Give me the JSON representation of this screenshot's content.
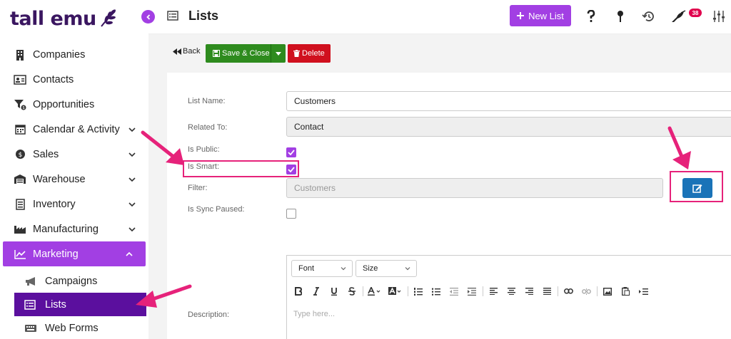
{
  "brand": {
    "name": "tall emu",
    "color": "#3a1660",
    "accent": "#a23fe3"
  },
  "sidebar": {
    "items": [
      {
        "label": "Companies",
        "icon": "building-icon",
        "expandable": false
      },
      {
        "label": "Contacts",
        "icon": "contact-card-icon",
        "expandable": false
      },
      {
        "label": "Opportunities",
        "icon": "funnel-icon",
        "expandable": false
      },
      {
        "label": "Calendar & Activity",
        "icon": "calendar-icon",
        "expandable": true
      },
      {
        "label": "Sales",
        "icon": "dollar-coin-icon",
        "expandable": true
      },
      {
        "label": "Warehouse",
        "icon": "warehouse-icon",
        "expandable": true
      },
      {
        "label": "Inventory",
        "icon": "inventory-icon",
        "expandable": true
      },
      {
        "label": "Manufacturing",
        "icon": "factory-icon",
        "expandable": true
      },
      {
        "label": "Marketing",
        "icon": "chart-icon",
        "expandable": true,
        "active": true
      }
    ],
    "subitems": [
      {
        "label": "Campaigns",
        "icon": "megaphone-icon"
      },
      {
        "label": "Lists",
        "icon": "list-icon",
        "current": true
      },
      {
        "label": "Web Forms",
        "icon": "keyboard-icon"
      }
    ]
  },
  "header": {
    "title": "Lists",
    "new_button": "New List",
    "notification_count": "38"
  },
  "toolbar": {
    "back_label": "Back",
    "save_close_label": "Save & Close",
    "delete_label": "Delete"
  },
  "form": {
    "list_name_label": "List Name:",
    "list_name_value": "Customers",
    "related_to_label": "Related To:",
    "related_to_value": "Contact",
    "is_public_label": "Is Public:",
    "is_public": true,
    "is_smart_label": "Is Smart:",
    "is_smart": true,
    "filter_label": "Filter:",
    "filter_placeholder": "Customers",
    "sync_paused_label": "Is Sync Paused:",
    "sync_paused": false,
    "description_label": "Description:"
  },
  "editor": {
    "font_select": "Font",
    "size_select": "Size",
    "placeholder": "Type here..."
  },
  "colors": {
    "save_green": "#2e8b1e",
    "delete_red": "#d0101e",
    "edit_blue": "#1a73b8",
    "highlight_pink": "#e6227a",
    "current_nav": "#5b0f9e"
  }
}
